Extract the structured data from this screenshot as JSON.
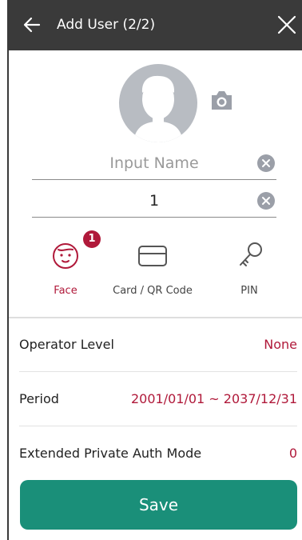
{
  "header": {
    "title": "Add User (2/2)",
    "back_icon": "arrow-left-icon",
    "close_icon": "close-icon"
  },
  "profile": {
    "avatar_icon": "user-avatar-icon",
    "camera_icon": "camera-icon"
  },
  "name_field": {
    "placeholder": "Input Name",
    "value": ""
  },
  "id_field": {
    "value": "1"
  },
  "auth_methods": [
    {
      "label": "Face",
      "icon": "face-icon",
      "badge": "1",
      "active": true
    },
    {
      "label": "Card / QR Code",
      "icon": "card-icon",
      "active": false
    },
    {
      "label": "PIN",
      "icon": "key-icon",
      "active": false
    }
  ],
  "settings": [
    {
      "label": "Operator Level",
      "value": "None"
    },
    {
      "label": "Period",
      "value": "2001/01/01 ~ 2037/12/31"
    },
    {
      "label": "Extended Private Auth Mode",
      "value": "0"
    }
  ],
  "save_label": "Save",
  "colors": {
    "header_bg": "#3a3a3a",
    "accent": "#b0193a",
    "save_bg": "#1a8f79",
    "avatar_bg": "#b8bcc2"
  }
}
